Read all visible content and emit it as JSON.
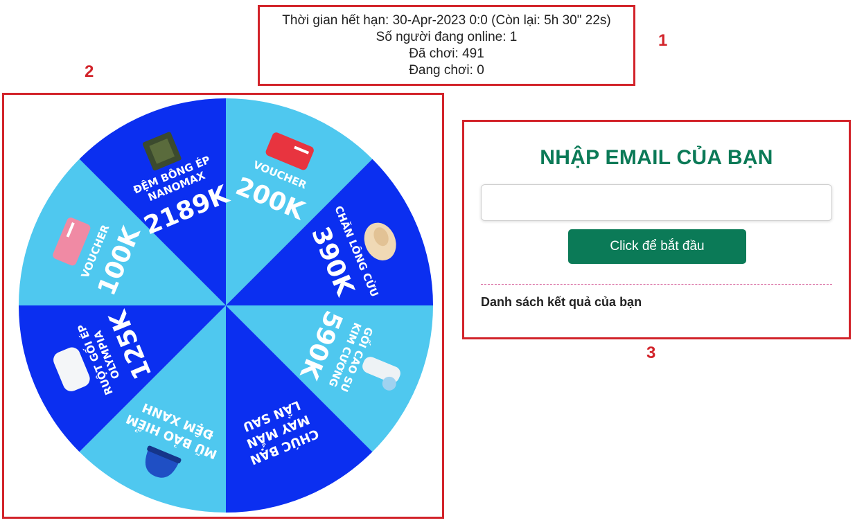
{
  "annotations": [
    "1",
    "2",
    "3"
  ],
  "info": {
    "expiry": "Thời gian hết hạn: 30-Apr-2023 0:0 (Còn lại: 5h 30\" 22s)",
    "online": "Số người đang online: 1",
    "played": "Đã chơi: 491",
    "playing": "Đang chơi: 0"
  },
  "colors": {
    "dark_blue": "#0b2ff0",
    "light_blue": "#4fc8ef",
    "green": "#0b7a57",
    "annotation_red": "#d2232a"
  },
  "wheel": {
    "segments": [
      {
        "lines": [
          "VOUCHER"
        ],
        "value": "200K",
        "icon": "voucher-card-icon",
        "color": "light"
      },
      {
        "lines": [
          "CHĂN LÔNG CỪU"
        ],
        "value": "390K",
        "icon": "wool-blanket-icon",
        "color": "dark"
      },
      {
        "lines": [
          "GỐI CAO SU",
          "KIM CƯƠNG"
        ],
        "value": "590K",
        "icon": "rubber-pillow-icon",
        "color": "light"
      },
      {
        "lines": [
          "CHÚC BẠN",
          "MAY MẮN",
          "LẦN SAU"
        ],
        "value": "",
        "icon": "",
        "color": "dark"
      },
      {
        "lines": [
          "MŨ BẢO HIỂM",
          "ĐỆM XANH"
        ],
        "value": "",
        "icon": "helmet-icon",
        "color": "light"
      },
      {
        "lines": [
          "RUỘT GỐI ÉP",
          "OLYMPIA"
        ],
        "value": "125K",
        "icon": "pillow-icon",
        "color": "dark"
      },
      {
        "lines": [
          "VOUCHER"
        ],
        "value": "100K",
        "icon": "voucher-card-icon",
        "color": "light"
      },
      {
        "lines": [
          "ĐỆM BÔNG ÉP",
          "NANOMAX"
        ],
        "value": "2189K",
        "icon": "mattress-icon",
        "color": "dark"
      }
    ]
  },
  "form": {
    "title": "NHẬP EMAIL CỦA BẠN",
    "email_value": "",
    "start_label": "Click để bắt đầu",
    "results_heading": "Danh sách kết quả của bạn"
  }
}
